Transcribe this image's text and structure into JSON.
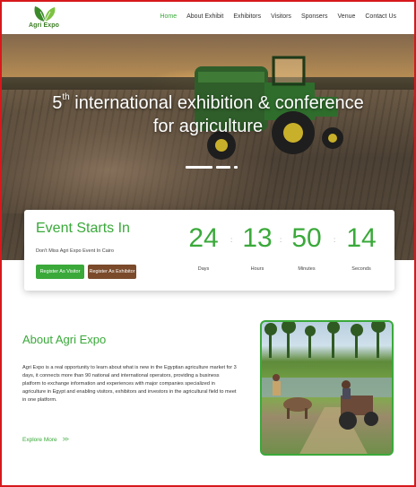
{
  "brand": {
    "name": "Agri Expo"
  },
  "nav": {
    "items": [
      {
        "label": "Home",
        "active": true
      },
      {
        "label": "About Exhibit",
        "active": false
      },
      {
        "label": "Exhibitors",
        "active": false
      },
      {
        "label": "Visitors",
        "active": false
      },
      {
        "label": "Sponsers",
        "active": false
      },
      {
        "label": "Venue",
        "active": false
      },
      {
        "label": "Contact Us",
        "active": false
      }
    ]
  },
  "hero": {
    "title_pre": "5",
    "title_sup": "th",
    "title_line1_rest": " international exhibition & conference",
    "title_line2": "for agriculture"
  },
  "countdown": {
    "title": "Event Starts In",
    "subtitle": "Don't Miss Agri Expo Event In Cairo",
    "register_visitor": "Register As Visitor",
    "register_exhibitor": "Register As Exhibitor",
    "units": [
      {
        "value": "24",
        "label": "Days"
      },
      {
        "value": "13",
        "label": "Hours"
      },
      {
        "value": "50",
        "label": "Minutes"
      },
      {
        "value": "14",
        "label": "Seconds"
      }
    ],
    "separator": ":"
  },
  "about": {
    "title": "About Agri Expo",
    "text": "Agri Expo is a real opportunity to learn about what is new in the Egyptian agriculture market for 3 days, it connects more than 90 national and international operators, providing a business platform to exchange information and experiences with major companies specialized in agriculture in Egypt and enabling visitors, exhibitors and investors in  the agricultural field to meet in one platform.",
    "explore_label": "Explore More",
    "explore_chevron": ">>"
  },
  "colors": {
    "accent": "#3aa93a",
    "brown": "#7a4a2b",
    "frame": "#d7191c"
  }
}
